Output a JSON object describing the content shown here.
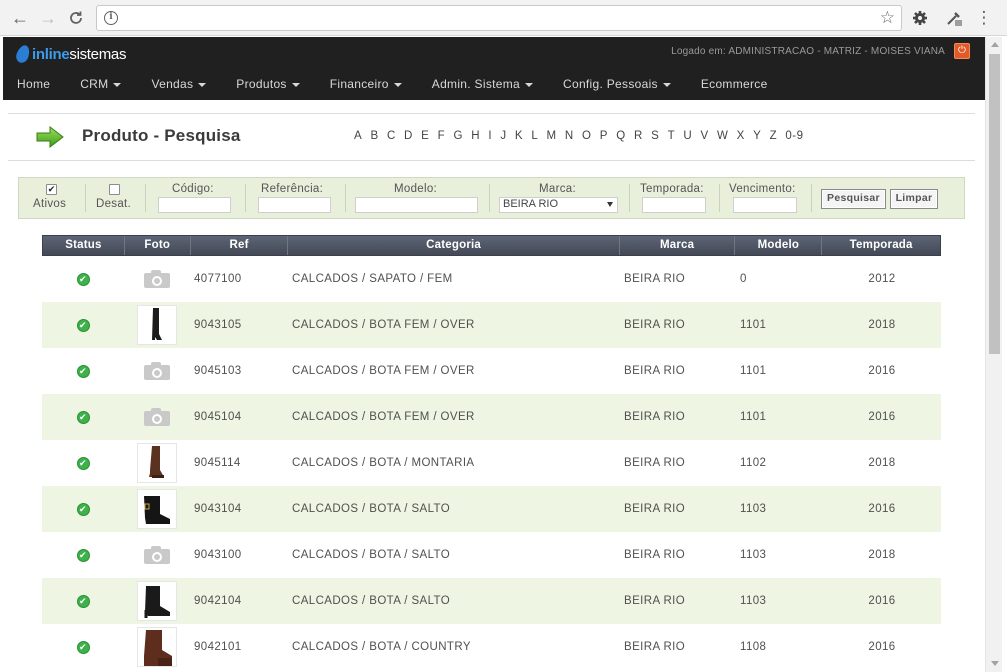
{
  "browser": {
    "url": ""
  },
  "header": {
    "logo_inline": "inline",
    "logo_sistemas": "sistemas",
    "logged_text": "Logado em: ADMINISTRACAO - MATRIZ - MOISES VIANA"
  },
  "menu": [
    {
      "label": "Home",
      "dropdown": false
    },
    {
      "label": "CRM",
      "dropdown": true
    },
    {
      "label": "Vendas",
      "dropdown": true
    },
    {
      "label": "Produtos",
      "dropdown": true
    },
    {
      "label": "Financeiro",
      "dropdown": true
    },
    {
      "label": "Admin. Sistema",
      "dropdown": true
    },
    {
      "label": "Config. Pessoais",
      "dropdown": true
    },
    {
      "label": "Ecommerce",
      "dropdown": false
    }
  ],
  "page": {
    "title": "Produto - Pesquisa",
    "alphabet": [
      "A",
      "B",
      "C",
      "D",
      "E",
      "F",
      "G",
      "H",
      "I",
      "J",
      "K",
      "L",
      "M",
      "N",
      "O",
      "P",
      "Q",
      "R",
      "S",
      "T",
      "U",
      "V",
      "W",
      "X",
      "Y",
      "Z",
      "0-9"
    ]
  },
  "filter": {
    "ativos_label": "Ativos",
    "ativos_checked": true,
    "desat_label": "Desat.",
    "desat_checked": false,
    "codigo_label": "Código:",
    "codigo_value": "",
    "referencia_label": "Referência:",
    "referencia_value": "",
    "modelo_label": "Modelo:",
    "modelo_value": "",
    "marca_label": "Marca:",
    "marca_value": "BEIRA RIO",
    "temporada_label": "Temporada:",
    "temporada_value": "",
    "vencimento_label": "Vencimento:",
    "vencimento_value": "",
    "search_button": "Pesquisar",
    "clear_button": "Limpar"
  },
  "table": {
    "columns": [
      "Status",
      "Foto",
      "Ref",
      "Categoria",
      "Marca",
      "Modelo",
      "Temporada"
    ],
    "rows": [
      {
        "status": "ok",
        "photo": "placeholder",
        "ref": "4077100",
        "categoria": "CALCADOS / SAPATO / FEM",
        "marca": "BEIRA RIO",
        "modelo": "0",
        "temporada": "2012"
      },
      {
        "status": "ok",
        "photo": "tall-black-boot",
        "ref": "9043105",
        "categoria": "CALCADOS / BOTA FEM / OVER",
        "marca": "BEIRA RIO",
        "modelo": "1101",
        "temporada": "2018"
      },
      {
        "status": "ok",
        "photo": "placeholder",
        "ref": "9045103",
        "categoria": "CALCADOS / BOTA FEM / OVER",
        "marca": "BEIRA RIO",
        "modelo": "1101",
        "temporada": "2016"
      },
      {
        "status": "ok",
        "photo": "placeholder",
        "ref": "9045104",
        "categoria": "CALCADOS / BOTA FEM / OVER",
        "marca": "BEIRA RIO",
        "modelo": "1101",
        "temporada": "2016"
      },
      {
        "status": "ok",
        "photo": "brown-riding-boot",
        "ref": "9045114",
        "categoria": "CALCADOS / BOTA / MONTARIA",
        "marca": "BEIRA RIO",
        "modelo": "1102",
        "temporada": "2018"
      },
      {
        "status": "ok",
        "photo": "black-buckle-bootie",
        "ref": "9043104",
        "categoria": "CALCADOS / BOTA / SALTO",
        "marca": "BEIRA RIO",
        "modelo": "1103",
        "temporada": "2016"
      },
      {
        "status": "ok",
        "photo": "placeholder",
        "ref": "9043100",
        "categoria": "CALCADOS / BOTA / SALTO",
        "marca": "BEIRA RIO",
        "modelo": "1103",
        "temporada": "2018"
      },
      {
        "status": "ok",
        "photo": "black-ankle-bootie",
        "ref": "9042104",
        "categoria": "CALCADOS / BOTA / SALTO",
        "marca": "BEIRA RIO",
        "modelo": "1103",
        "temporada": "2016"
      },
      {
        "status": "ok",
        "photo": "brown-country-boot",
        "ref": "9042101",
        "categoria": "CALCADOS / BOTA / COUNTRY",
        "marca": "BEIRA RIO",
        "modelo": "1108",
        "temporada": "2016"
      }
    ]
  }
}
